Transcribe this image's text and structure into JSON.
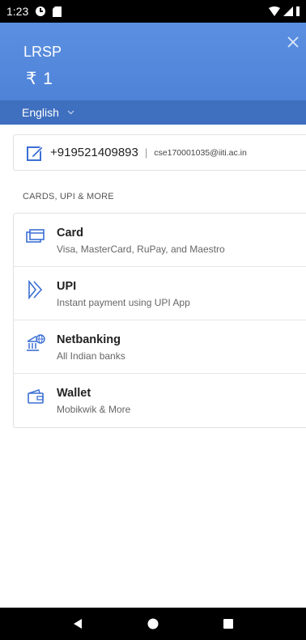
{
  "status_bar": {
    "time": "1:23",
    "icons": [
      "data-saver-icon",
      "sd-card-icon",
      "wifi-icon",
      "signal-icon",
      "battery-icon"
    ]
  },
  "header": {
    "merchant": "LRSP",
    "amount": "₹ 1",
    "language": "English",
    "colors": {
      "background": "#5b8fe0",
      "language_bar": "#3f6fbf"
    }
  },
  "contact": {
    "phone": "+919521409893",
    "separator": "|",
    "email": "cse170001035@iiti.ac.in"
  },
  "section": {
    "title": "CARDS, UPI & MORE"
  },
  "methods": [
    {
      "name": "Card",
      "description": "Visa, MasterCard, RuPay, and Maestro",
      "icon": "card-icon"
    },
    {
      "name": "UPI",
      "description": "Instant payment using UPI App",
      "icon": "upi-icon"
    },
    {
      "name": "Netbanking",
      "description": "All Indian banks",
      "icon": "bank-icon"
    },
    {
      "name": "Wallet",
      "description": "Mobikwik & More",
      "icon": "wallet-icon"
    }
  ],
  "nav": {
    "icons": [
      "back-icon",
      "home-icon",
      "recents-icon"
    ]
  },
  "accent_color": "#3b6fd4"
}
